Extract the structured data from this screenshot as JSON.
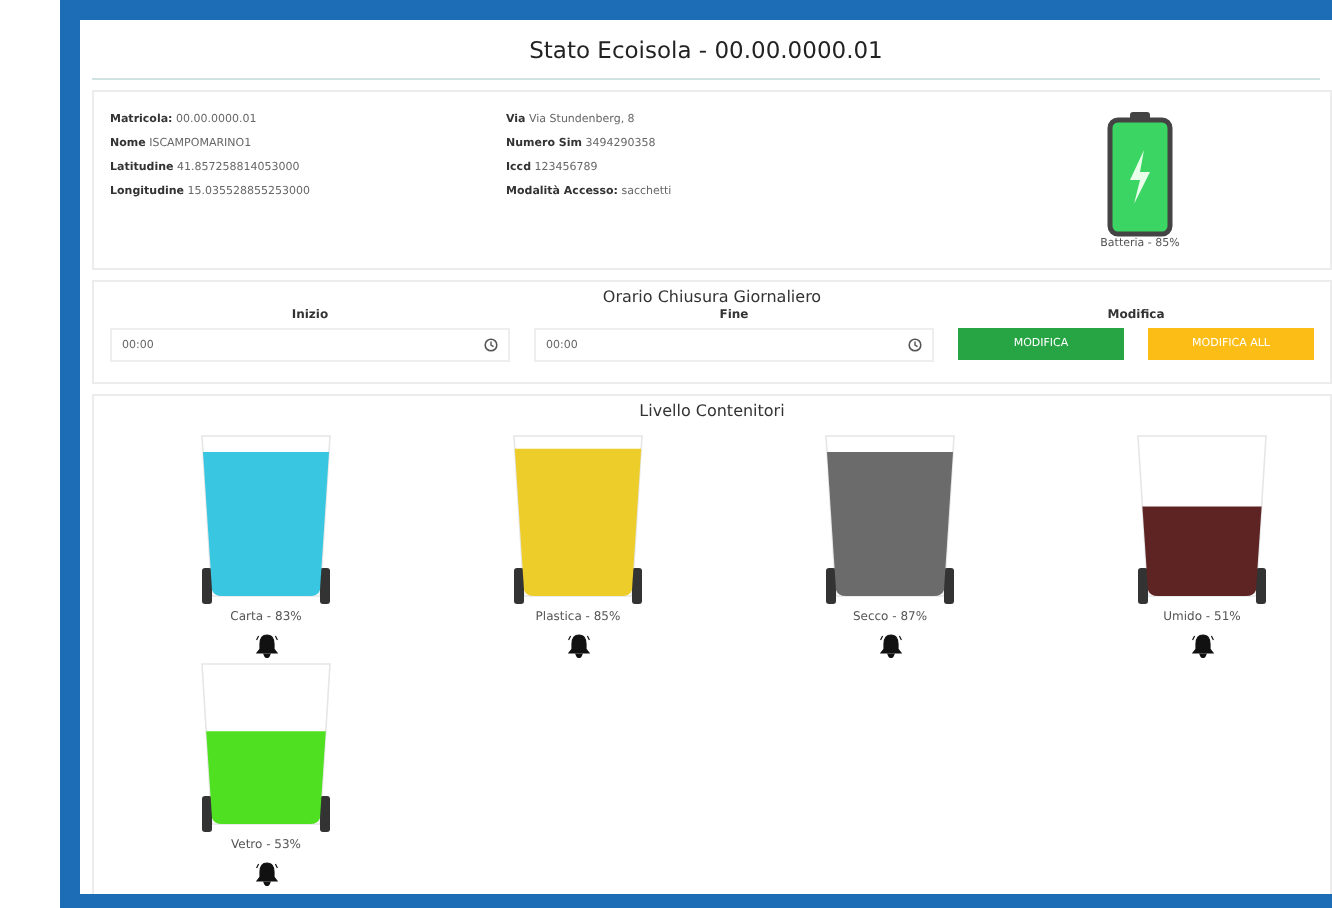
{
  "title": "Stato Ecoisola - 00.00.0000.01",
  "info": {
    "left": [
      {
        "label": "Matricola:",
        "value": "00.00.0000.01"
      },
      {
        "label": "Nome",
        "value": "ISCAMPOMARINO1"
      },
      {
        "label": "Latitudine",
        "value": "41.857258814053000"
      },
      {
        "label": "Longitudine",
        "value": "15.035528855253000"
      }
    ],
    "right": [
      {
        "label": "Via",
        "value": "Via Stundenberg, 8"
      },
      {
        "label": "Numero Sim",
        "value": "3494290358"
      },
      {
        "label": "Iccd",
        "value": "123456789"
      },
      {
        "label": "Modalità Accesso:",
        "value": "sacchetti"
      }
    ],
    "battery": {
      "label": "Batteria - 85%"
    }
  },
  "schedule": {
    "title": "Orario Chiusura Giornaliero",
    "start_label": "Inizio",
    "start_value": "00:00",
    "end_label": "Fine",
    "end_value": "00:00",
    "actions_label": "Modifica",
    "buttons": [
      {
        "label": "MODIFICA",
        "kind": "primary"
      },
      {
        "label": "MODIFICA ALL",
        "kind": "warning"
      }
    ]
  },
  "containers": {
    "title": "Livello Contenitori",
    "bins": [
      {
        "label": "Carta - 83%",
        "level": 0.9,
        "color": "#38c6e0"
      },
      {
        "label": "Plastica - 85%",
        "level": 0.92,
        "color": "#eccd2a"
      },
      {
        "label": "Secco - 87%",
        "level": 0.9,
        "color": "#6b6b6b"
      },
      {
        "label": "Umido - 51%",
        "level": 0.56,
        "color": "#5e2424"
      },
      {
        "label": "Vetro - 53%",
        "level": 0.58,
        "color": "#4fe021"
      }
    ]
  }
}
